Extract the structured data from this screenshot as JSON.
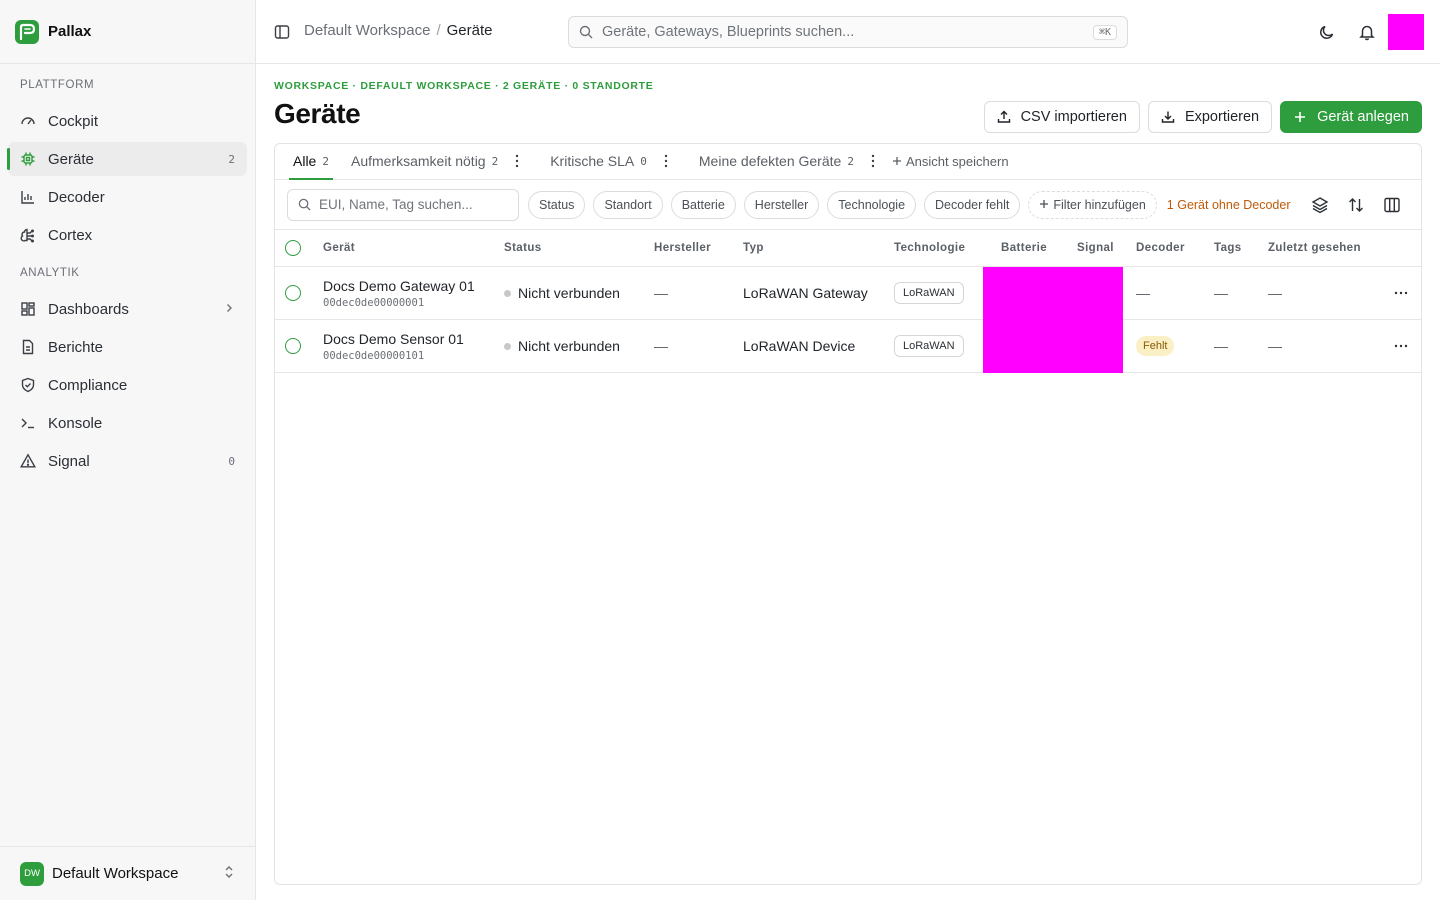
{
  "brand": {
    "name": "Pallax"
  },
  "sidebar": {
    "sections": [
      {
        "heading": "Plattform",
        "items": [
          {
            "label": "Cockpit",
            "icon": "gauge-icon"
          },
          {
            "label": "Geräte",
            "icon": "chip-icon",
            "count": "2",
            "active": true
          },
          {
            "label": "Decoder",
            "icon": "bar-chart-icon"
          },
          {
            "label": "Cortex",
            "icon": "brain-icon"
          }
        ]
      },
      {
        "heading": "Analytik",
        "items": [
          {
            "label": "Dashboards",
            "icon": "dashboard-icon",
            "chevron": true
          },
          {
            "label": "Berichte",
            "icon": "file-icon"
          },
          {
            "label": "Compliance",
            "icon": "shield-icon"
          },
          {
            "label": "Konsole",
            "icon": "terminal-icon"
          },
          {
            "label": "Signal",
            "icon": "warning-icon",
            "count": "0"
          }
        ]
      }
    ],
    "workspace": {
      "initials": "DW",
      "name": "Default Workspace"
    }
  },
  "topbar": {
    "breadcrumb": {
      "parent": "Default Workspace",
      "separator": "/",
      "current": "Geräte"
    },
    "search": {
      "placeholder": "Geräte, Gateways, Blueprints suchen...",
      "shortcut": "⌘K"
    }
  },
  "page": {
    "eyebrow": "Workspace · Default Workspace · 2 Geräte · 0 Standorte",
    "title": "Geräte",
    "actions": {
      "import": "CSV importieren",
      "export": "Exportieren",
      "create": "Gerät anlegen"
    }
  },
  "tabs": [
    {
      "label": "Alle",
      "count": "2",
      "active": true
    },
    {
      "label": "Aufmerksamkeit nötig",
      "count": "2"
    },
    {
      "label": "Kritische SLA",
      "count": "0"
    },
    {
      "label": "Meine defekten Geräte",
      "count": "2"
    }
  ],
  "save_view": "Ansicht speichern",
  "filters": {
    "search_placeholder": "EUI, Name, Tag suchen...",
    "chips": [
      "Status",
      "Standort",
      "Batterie",
      "Hersteller",
      "Technologie",
      "Decoder fehlt"
    ],
    "add_filter": "Filter hinzufügen",
    "warning": "1 Gerät ohne Decoder"
  },
  "table": {
    "columns": {
      "device": "Gerät",
      "status": "Status",
      "manufacturer": "Hersteller",
      "type": "Typ",
      "technology": "Technologie",
      "battery": "Batterie",
      "signal": "Signal",
      "decoder": "Decoder",
      "tags": "Tags",
      "last_seen": "Zuletzt gesehen"
    },
    "rows": [
      {
        "name": "Docs Demo Gateway 01",
        "eui": "00dec0de00000001",
        "status": "Nicht verbunden",
        "manufacturer": "—",
        "type": "LoRaWAN Gateway",
        "technology": "LoRaWAN",
        "decoder": "—",
        "tags": "—",
        "last_seen": "—"
      },
      {
        "name": "Docs Demo Sensor 01",
        "eui": "00dec0de00000101",
        "status": "Nicht verbunden",
        "manufacturer": "—",
        "type": "LoRaWAN Device",
        "technology": "LoRaWAN",
        "decoder": "Fehlt",
        "tags": "—",
        "last_seen": "—"
      }
    ]
  },
  "colors": {
    "accent": "#2e9d3e",
    "warning": "#c05a08",
    "placeholder_block": "#ff00ff"
  }
}
